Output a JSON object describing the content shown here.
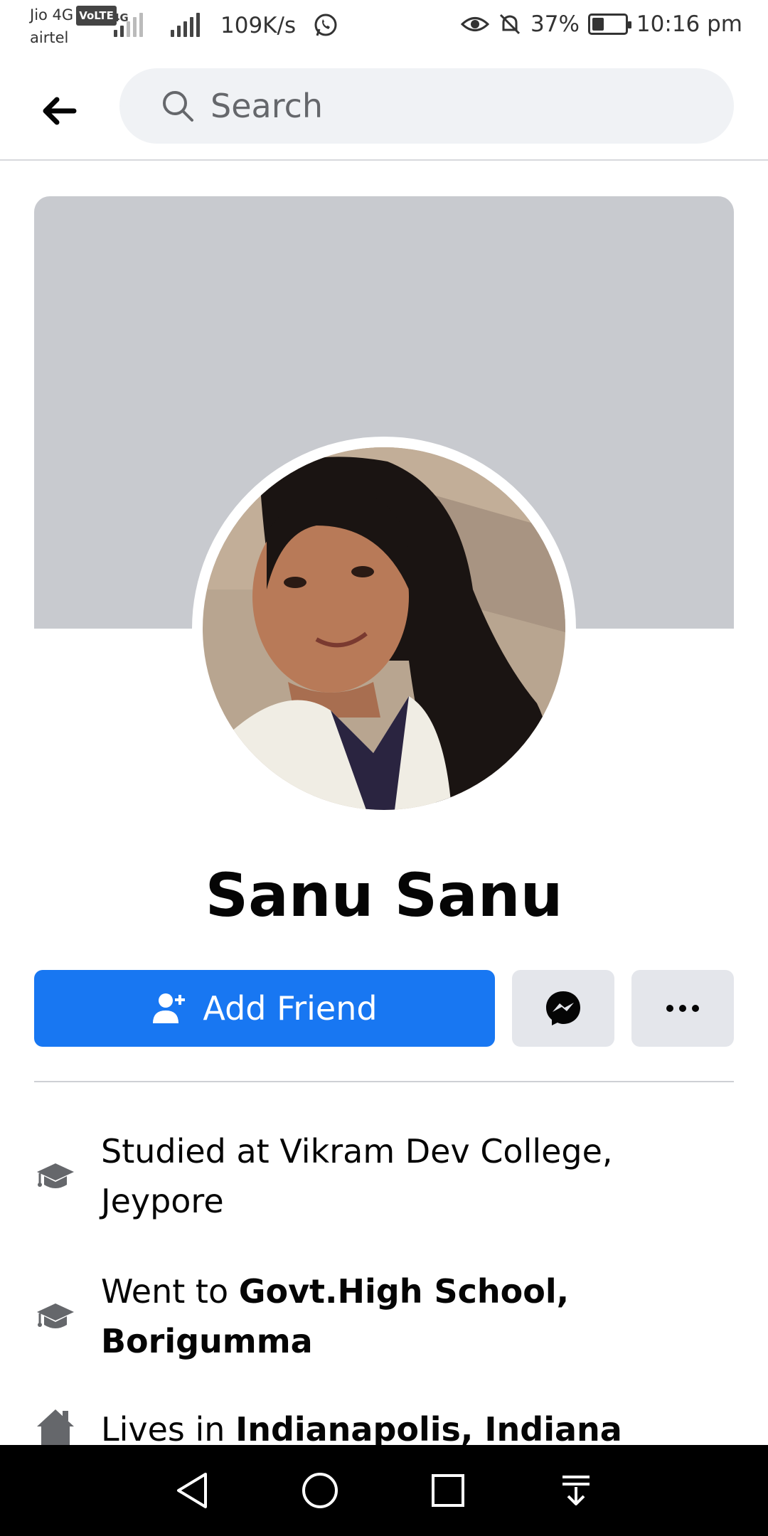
{
  "status_bar": {
    "carrier_top": "Jio 4G",
    "volte": "VoLTE",
    "carrier_bottom": "airtel",
    "network_type": "4G",
    "speed": "109K/s",
    "battery": "37%",
    "battery_level": 0.37,
    "time": "10:16 pm"
  },
  "search": {
    "placeholder": "Search"
  },
  "profile": {
    "name": "Sanu Sanu",
    "add_friend_label": "Add Friend"
  },
  "info": {
    "studied": "Studied at Vikram Dev College, Jeypore",
    "went_prefix": "Went to ",
    "went_school": "Govt.High School, Borigumma",
    "lives_prefix": "Lives in ",
    "lives_place": "Indianapolis, Indiana"
  },
  "colors": {
    "accent": "#1877f2",
    "cover": "#c8cacf",
    "button_grey": "#e4e6eb"
  }
}
